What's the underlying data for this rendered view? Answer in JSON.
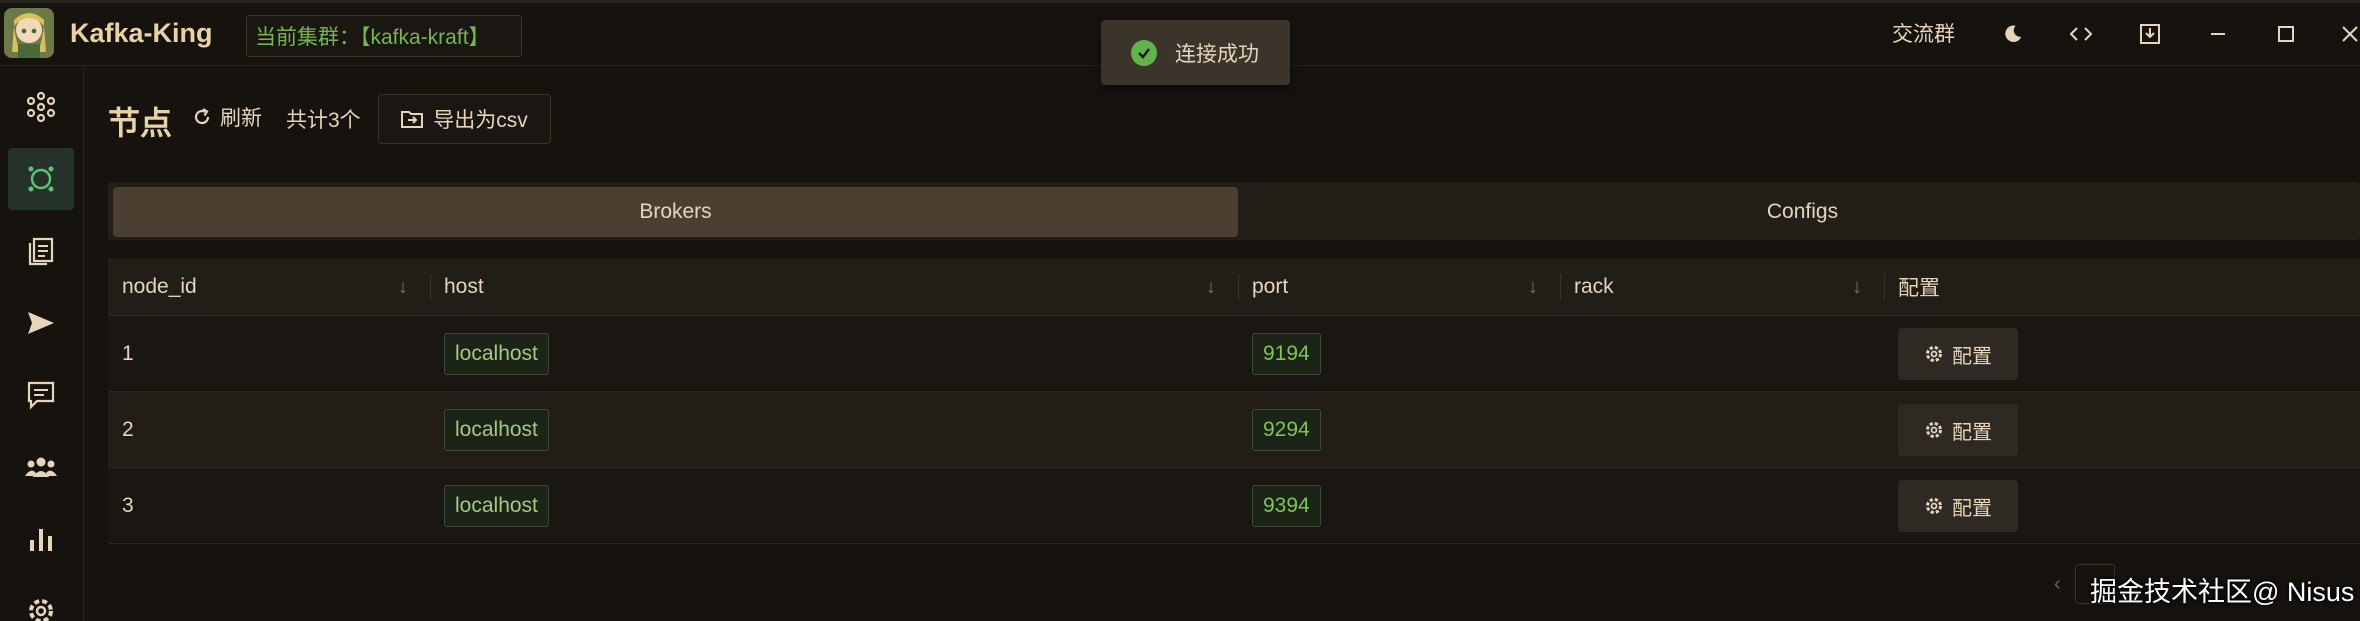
{
  "app": {
    "title": "Kafka-King",
    "cluster_label": "当前集群：【kafka-kraft】"
  },
  "toast": {
    "message": "连接成功"
  },
  "titlebar": {
    "community_link": "交流群",
    "icons": [
      "moon-icon",
      "code-icon",
      "download-icon",
      "minimize-icon",
      "maximize-icon",
      "close-icon"
    ]
  },
  "sidebar": {
    "items": [
      {
        "icon": "cluster-icon"
      },
      {
        "icon": "node-icon",
        "active": true
      },
      {
        "icon": "topics-icon"
      },
      {
        "icon": "send-icon"
      },
      {
        "icon": "message-icon"
      },
      {
        "icon": "groups-icon"
      },
      {
        "icon": "monitor-icon"
      },
      {
        "icon": "settings-icon"
      }
    ]
  },
  "page": {
    "title": "节点",
    "refresh_label": "刷新",
    "count_label": "共计3个",
    "export_label": "导出为csv"
  },
  "tabs": [
    {
      "label": "Brokers",
      "active": true
    },
    {
      "label": "Configs",
      "active": false
    }
  ],
  "table": {
    "columns": [
      "node_id",
      "host",
      "port",
      "rack",
      "配置"
    ],
    "rows": [
      {
        "node_id": "1",
        "host": "localhost",
        "port": "9194",
        "rack": "",
        "action": "配置"
      },
      {
        "node_id": "2",
        "host": "localhost",
        "port": "9294",
        "rack": "",
        "action": "配置"
      },
      {
        "node_id": "3",
        "host": "localhost",
        "port": "9394",
        "rack": "",
        "action": "配置"
      }
    ]
  },
  "watermark": "掘金技术社区@ Nisus",
  "colors": {
    "accent_green": "#63b34d",
    "active_tab": "#4a3f31",
    "background": "#16130f"
  }
}
